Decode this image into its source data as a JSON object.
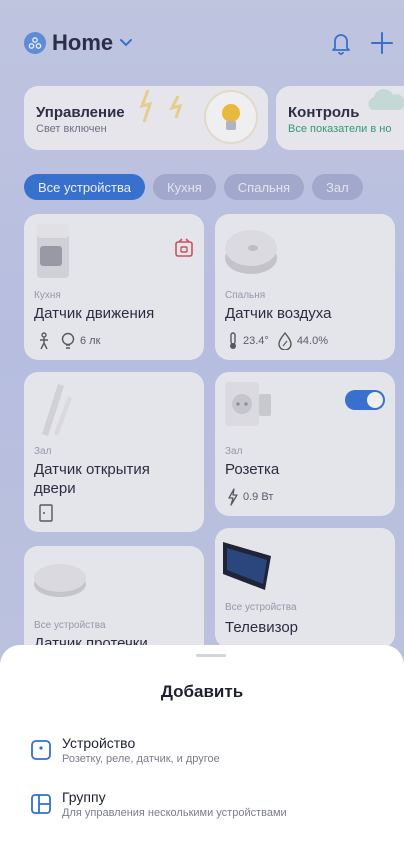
{
  "header": {
    "title": "Home",
    "home_icon": "home-icon",
    "bell_icon": "bell-icon",
    "add_icon": "plus-icon"
  },
  "scenarios": [
    {
      "title": "Управление",
      "subtitle": "Свет включен"
    },
    {
      "title": "Контроль",
      "subtitle": "Все показатели в но",
      "subtitle_color": "#2ba06a"
    }
  ],
  "tabs": [
    "Все устройства",
    "Кухня",
    "Спальня",
    "Зал"
  ],
  "devices": [
    {
      "room": "Кухня",
      "name": "Датчик движения",
      "metric": "6 лк"
    },
    {
      "room": "Спальня",
      "name": "Датчик воздуха",
      "temp": "23.4°",
      "humidity": "44.0%"
    },
    {
      "room": "Зал",
      "name": "Датчик открытия двери"
    },
    {
      "room": "Зал",
      "name": "Розетка",
      "power": "0.9 Вт",
      "switch_on": true
    },
    {
      "room": "Все устройства",
      "name": "Датчик протечки"
    },
    {
      "room": "Все устройства",
      "name": "Телевизор"
    }
  ],
  "sheet": {
    "title": "Добавить",
    "options": [
      {
        "title": "Устройство",
        "subtitle": "Розетку, реле, датчик, и другое",
        "icon": "device-icon"
      },
      {
        "title": "Группу",
        "subtitle": "Для управления несколькими устройствами",
        "icon": "group-icon"
      }
    ]
  },
  "colors": {
    "accent": "#2f6fd6",
    "green": "#2ba06a",
    "badge": "#d64b5a"
  }
}
